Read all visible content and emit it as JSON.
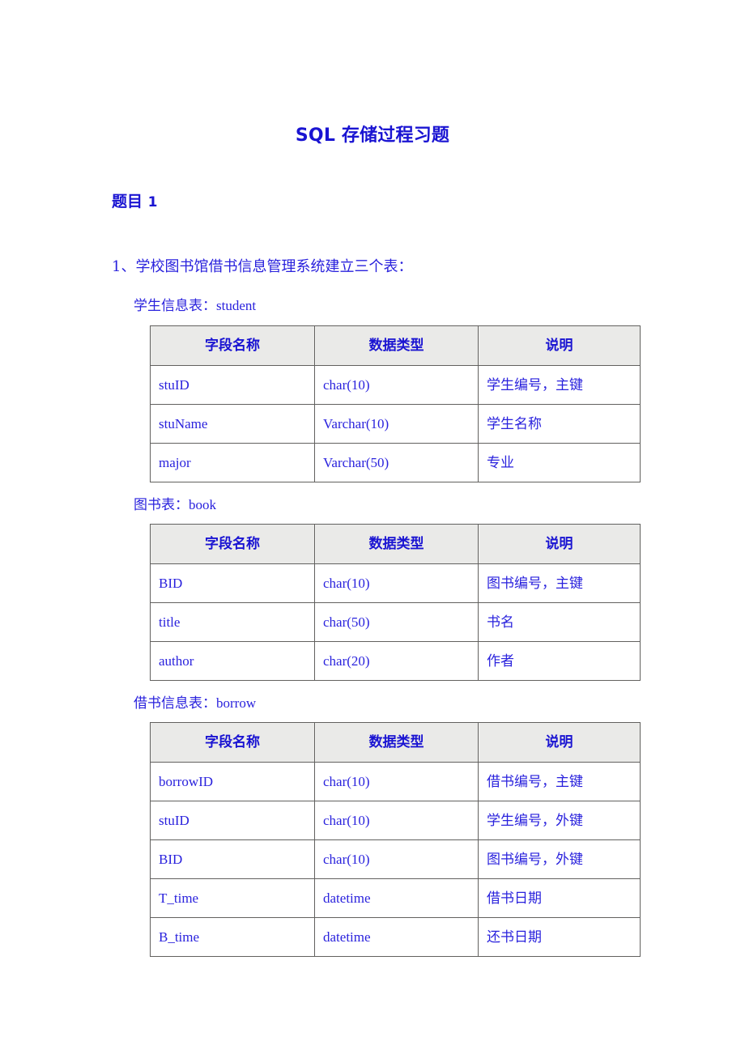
{
  "document": {
    "title": "SQL 存储过程习题",
    "title_latin": "SQL",
    "title_cjk": "存储过程习题",
    "section_heading": "题目 1",
    "section_heading_text": "题目",
    "section_heading_number": "1",
    "intro_line": "1、学校图书馆借书信息管理系统建立三个表：",
    "text_color": "#2a22dd",
    "heading_color": "#1a14d2",
    "header_cell_bg": "#d7d6d2",
    "border_color": "#62615f",
    "page_bg": "#ffffff"
  },
  "columns": {
    "field_name": "字段名称",
    "data_type": "数据类型",
    "description": "说明"
  },
  "tables": [
    {
      "caption": "学生信息表：student",
      "caption_cjk": "学生信息表：",
      "caption_latin": "student",
      "rows": [
        {
          "field": "stuID",
          "type": "char(10)",
          "desc": "学生编号，主键"
        },
        {
          "field": "stuName",
          "type": "Varchar(10)",
          "desc": "学生名称"
        },
        {
          "field": "major",
          "type": "Varchar(50)",
          "desc": "专业"
        }
      ]
    },
    {
      "caption": "图书表：book",
      "caption_cjk": "图书表：",
      "caption_latin": "book",
      "rows": [
        {
          "field": "BID",
          "type": "char(10)",
          "desc": "图书编号，主键"
        },
        {
          "field": "title",
          "type": "char(50)",
          "desc": "书名"
        },
        {
          "field": "author",
          "type": "char(20)",
          "desc": "作者"
        }
      ]
    },
    {
      "caption": "借书信息表：borrow",
      "caption_cjk": "借书信息表：",
      "caption_latin": "borrow",
      "rows": [
        {
          "field": "borrowID",
          "type": "char(10)",
          "desc": "借书编号，主键"
        },
        {
          "field": "stuID",
          "type": "char(10)",
          "desc": "学生编号，外键"
        },
        {
          "field": "BID",
          "type": "char(10)",
          "desc": "图书编号，外键"
        },
        {
          "field": "T_time",
          "type": "datetime",
          "desc": "借书日期"
        },
        {
          "field": "B_time",
          "type": "datetime",
          "desc": "还书日期"
        }
      ]
    }
  ]
}
